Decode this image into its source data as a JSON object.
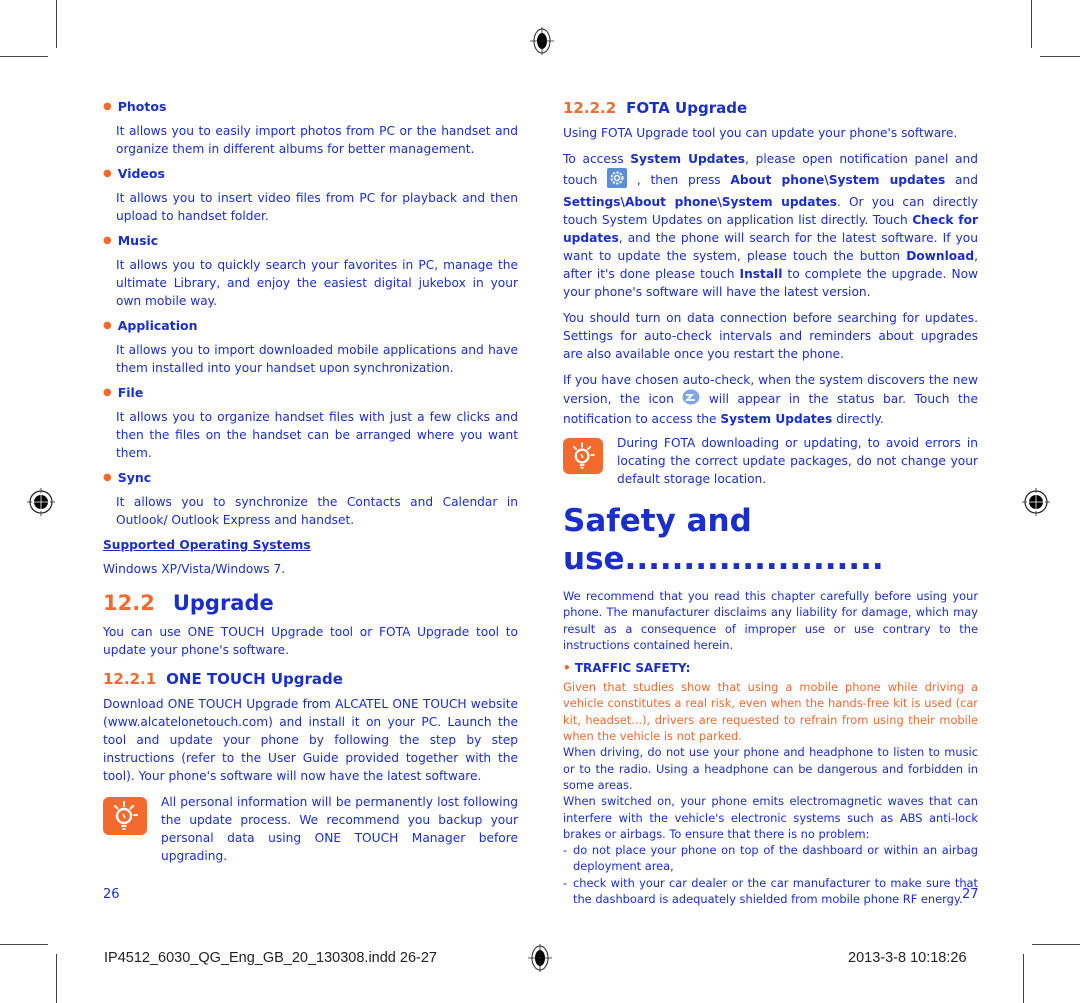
{
  "left_page": {
    "items": [
      {
        "title": "Photos",
        "body": "It allows you to easily import photos from PC or the handset and organize them in different albums for better management."
      },
      {
        "title": "Videos",
        "body": "It allows you to insert video files from PC for playback and then upload to handset folder."
      },
      {
        "title": "Music",
        "body": "It allows you to quickly search your favorites in PC, manage the ultimate Library, and enjoy the easiest digital jukebox in your own mobile way."
      },
      {
        "title": "Application",
        "body": "It allows you to import downloaded mobile applications and have them installed into your handset upon synchronization."
      },
      {
        "title": "File",
        "body": "It allows you to organize handset files with just a few clicks and then the files on the handset can be arranged where you want them."
      },
      {
        "title": "Sync",
        "body": "It allows you to synchronize the Contacts and Calendar in Outlook/ Outlook Express and handset."
      }
    ],
    "supported_os_heading": "Supported Operating Systems",
    "supported_os_text": "Windows XP/Vista/Windows 7.",
    "section": {
      "number": "12.2",
      "title": "Upgrade",
      "body": "You can use ONE TOUCH Upgrade tool or FOTA Upgrade tool to update your phone's software."
    },
    "subsection": {
      "number": "12.2.1",
      "title": "ONE TOUCH Upgrade",
      "body": "Download ONE TOUCH Upgrade from ALCATEL ONE TOUCH website (www.alcatelonetouch.com) and install it on your PC. Launch the tool and update your phone by following the step by step instructions (refer to the User Guide provided together with the tool). Your phone's software will now have the latest software."
    },
    "note": "All personal information will be permanently lost following the update process. We recommend you backup your personal data using ONE TOUCH Manager before upgrading.",
    "page_number": "26"
  },
  "right_page": {
    "subsection": {
      "number": "12.2.2",
      "title": "FOTA Upgrade"
    },
    "intro": "Using FOTA Upgrade tool you can update your phone's software.",
    "access": {
      "p1": "To access ",
      "b1": "System Updates",
      "p2": ", please open notification panel and touch ",
      "p3": " , then press ",
      "b2": "About phone\\System updates",
      "p4": " and ",
      "b3": "Settings\\About phone\\System updates",
      "p5": ". Or you can directly touch System Updates on application list directly. Touch ",
      "b4": "Check for updates",
      "p6": ", and the phone will search for the latest software. If you want to update the system, please touch the button ",
      "b5": "Download",
      "p7": ", after it's done please touch ",
      "b6": "Install",
      "p8": " to complete the upgrade. Now your phone's software will have the latest version."
    },
    "data_connection": "You should turn on data connection before searching for updates. Settings for auto-check intervals and reminders about upgrades are also available once you restart the phone.",
    "autocheck": {
      "p1": "If you have chosen auto-check, when the system discovers the new version, the  icon ",
      "p2": " will appear in the status bar. Touch the notification to access the ",
      "b1": "System Updates",
      "p3": " directly."
    },
    "note": "During FOTA downloading or updating, to avoid errors in locating the correct update packages, do not change your default storage location.",
    "chapter_title": "Safety and use......................",
    "chapter_intro": "We recommend that you read this chapter carefully before using your phone. The manufacturer disclaims any liability for damage, which may result as a consequence of improper use or use contrary to the instructions contained herein.",
    "traffic_heading": "TRAFFIC SAFETY:",
    "traffic_warning": "Given that studies show that using a mobile phone while driving a vehicle constitutes a real risk, even when the hands-free kit is used (car kit, headset...), drivers are requested to refrain from using their mobile when the vehicle is not parked.",
    "driving_text": "When driving, do not use your phone and headphone to listen to music or to the radio. Using a headphone can be dangerous and forbidden in some areas.",
    "em_text": "When switched on, your phone emits electromagnetic waves that can interfere with the vehicle's electronic systems such as ABS anti-lock brakes or airbags. To ensure that there is no problem:",
    "dash_items": [
      "do not place your phone on top of the dashboard or within an airbag deployment area,",
      "check with your car dealer or the car manufacturer to make sure that the dashboard is adequately shielded from mobile phone RF energy."
    ],
    "page_number": "27"
  },
  "footer": {
    "filename": "IP4512_6030_QG_Eng_GB_20_130308.indd   26-27",
    "timestamp": "2013-3-8   10:18:26"
  },
  "colors": {
    "text_blue": "#1a2ecc",
    "accent_orange": "#f26a2e"
  }
}
